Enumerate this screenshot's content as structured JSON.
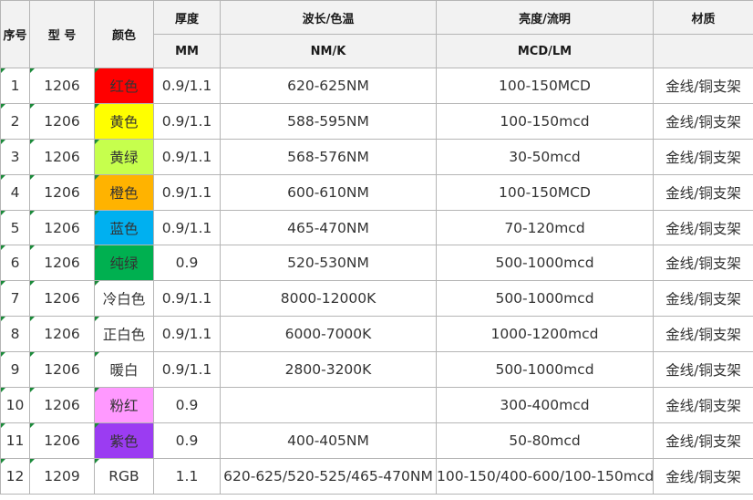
{
  "header": {
    "seq": "序号",
    "model": "型 号",
    "color": "颜色",
    "thickness": "厚度",
    "thickness_unit": "MM",
    "wavelength": "波长/色温",
    "wavelength_unit": "NM/K",
    "brightness": "亮度/流明",
    "brightness_unit": "MCD/LM",
    "material": "材质"
  },
  "colors": {
    "red": "#ff0000",
    "yellow": "#ffff00",
    "yellow_green": "#c6ff4d",
    "orange": "#ffb300",
    "blue": "#00b0f0",
    "green": "#00b050",
    "pink": "#ff99ff",
    "purple": "#9b3cf2"
  },
  "rows": [
    {
      "seq": "1",
      "model": "1206",
      "color": "红色",
      "swatch": "#ff0000",
      "thickness": "0.9/1.1",
      "wavelength": "620-625NM",
      "brightness": "100-150MCD",
      "material": "金线/铜支架"
    },
    {
      "seq": "2",
      "model": "1206",
      "color": "黄色",
      "swatch": "#ffff00",
      "thickness": "0.9/1.1",
      "wavelength": "588-595NM",
      "brightness": "100-150mcd",
      "material": "金线/铜支架"
    },
    {
      "seq": "3",
      "model": "1206",
      "color": "黄绿",
      "swatch": "#c6ff4d",
      "thickness": "0.9/1.1",
      "wavelength": "568-576NM",
      "brightness": "30-50mcd",
      "material": "金线/铜支架"
    },
    {
      "seq": "4",
      "model": "1206",
      "color": "橙色",
      "swatch": "#ffb300",
      "thickness": "0.9/1.1",
      "wavelength": "600-610NM",
      "brightness": "100-150MCD",
      "material": "金线/铜支架"
    },
    {
      "seq": "5",
      "model": "1206",
      "color": "蓝色",
      "swatch": "#00b0f0",
      "thickness": "0.9/1.1",
      "wavelength": "465-470NM",
      "brightness": "70-120mcd",
      "material": "金线/铜支架"
    },
    {
      "seq": "6",
      "model": "1206",
      "color": "纯绿",
      "swatch": "#00b050",
      "thickness": "0.9",
      "wavelength": "520-530NM",
      "brightness": "500-1000mcd",
      "material": "金线/铜支架"
    },
    {
      "seq": "7",
      "model": "1206",
      "color": "冷白色",
      "swatch": "",
      "thickness": "0.9/1.1",
      "wavelength": "8000-12000K",
      "brightness": "500-1000mcd",
      "material": "金线/铜支架"
    },
    {
      "seq": "8",
      "model": "1206",
      "color": "正白色",
      "swatch": "",
      "thickness": "0.9/1.1",
      "wavelength": "6000-7000K",
      "brightness": "1000-1200mcd",
      "material": "金线/铜支架"
    },
    {
      "seq": "9",
      "model": "1206",
      "color": "暖白",
      "swatch": "",
      "thickness": "0.9/1.1",
      "wavelength": "2800-3200K",
      "brightness": "500-1000mcd",
      "material": "金线/铜支架"
    },
    {
      "seq": "10",
      "model": "1206",
      "color": "粉红",
      "swatch": "#ff99ff",
      "thickness": "0.9",
      "wavelength": "",
      "brightness": "300-400mcd",
      "material": "金线/铜支架"
    },
    {
      "seq": "11",
      "model": "1206",
      "color": "紫色",
      "swatch": "#9b3cf2",
      "thickness": "0.9",
      "wavelength": "400-405NM",
      "brightness": "50-80mcd",
      "material": "金线/铜支架"
    },
    {
      "seq": "12",
      "model": "1209",
      "color": "RGB",
      "swatch": "",
      "thickness": "1.1",
      "wavelength": "620-625/520-525/465-470NM",
      "brightness": "100-150/400-600/100-150mcd",
      "material": "金线/铜支架"
    }
  ]
}
